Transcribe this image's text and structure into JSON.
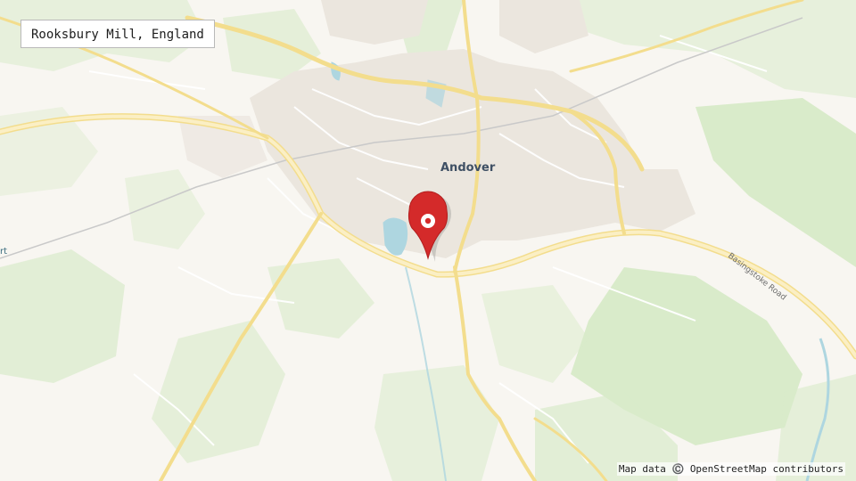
{
  "location": {
    "label": "Rooksbury Mill, England"
  },
  "map": {
    "town_label": "Andover",
    "road_label": "Basingstoke Road",
    "edge_label": "rt",
    "attribution": "Map data ©️ OpenStreetMap contributors",
    "colors": {
      "background": "#f8f6f1",
      "green": "#d8eac8",
      "urban": "#ebe7e0",
      "major_road": "#f6e49c",
      "water": "#a9d3df",
      "marker": "#d42a2a"
    }
  }
}
